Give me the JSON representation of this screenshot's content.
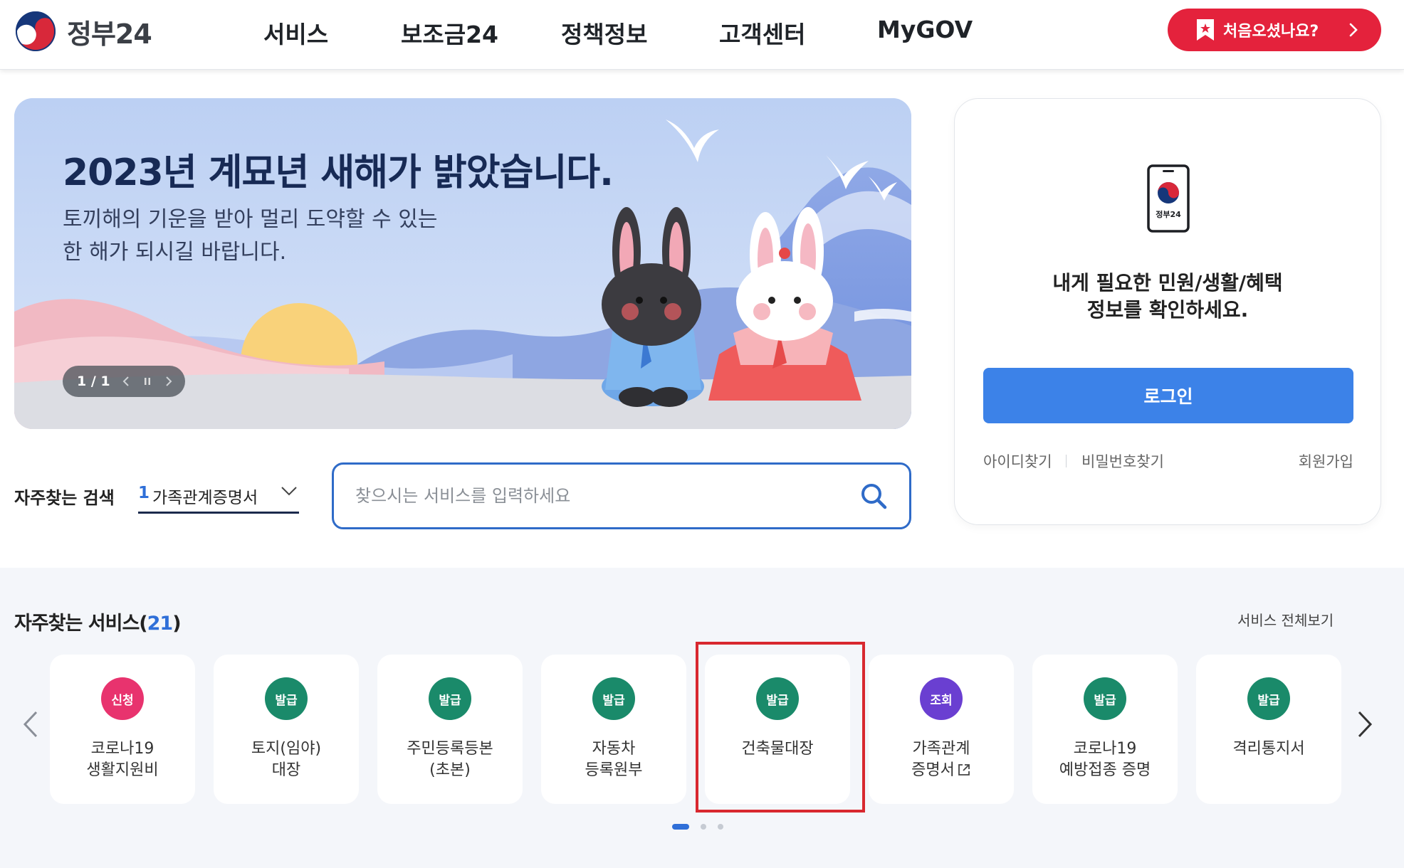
{
  "header": {
    "logo_text": "정부24",
    "nav": [
      "서비스",
      "보조금24",
      "정책정보",
      "고객센터",
      "MyGOV"
    ],
    "first_visit_label": "처음오셨나요?",
    "accent_color": "#e4223c"
  },
  "banner": {
    "title": "2023년 계묘년 새해가 밝았습니다.",
    "subtitle_line1": "토끼해의 기운을 받아 멀리 도약할 수 있는",
    "subtitle_line2": "한 해가 되시길 바랍니다.",
    "pagination": "1 / 1"
  },
  "login": {
    "phone_label": "정부24",
    "message_line1": "내게 필요한 민원/생활/혜택",
    "message_line2": "정보를 확인하세요.",
    "login_button": "로그인",
    "find_id": "아이디찾기",
    "find_pw": "비밀번호찾기",
    "signup": "회원가입",
    "button_color": "#3c82e8"
  },
  "search": {
    "frequent_label": "자주찾는 검색",
    "selected_rank": "1",
    "selected_value": "가족관계증명서",
    "placeholder": "찾으시는 서비스를 입력하세요"
  },
  "services": {
    "title": "자주찾는 서비스",
    "count": "21",
    "view_all": "서비스 전체보기",
    "items": [
      {
        "badge": "신청",
        "badge_color": "#e8336e",
        "name": "코로나19\n생활지원비"
      },
      {
        "badge": "발급",
        "badge_color": "#1a8a6a",
        "name": "토지(임야)\n대장"
      },
      {
        "badge": "발급",
        "badge_color": "#1a8a6a",
        "name": "주민등록등본\n(초본)"
      },
      {
        "badge": "발급",
        "badge_color": "#1a8a6a",
        "name": "자동차\n등록원부"
      },
      {
        "badge": "발급",
        "badge_color": "#1a8a6a",
        "name": "건축물대장"
      },
      {
        "badge": "조회",
        "badge_color": "#6a3fd1",
        "name": "가족관계\n증명서"
      },
      {
        "badge": "발급",
        "badge_color": "#1a8a6a",
        "name": "코로나19\n예방접종 증명"
      },
      {
        "badge": "발급",
        "badge_color": "#1a8a6a",
        "name": "격리통지서"
      }
    ],
    "highlight_color": "#d8282f"
  }
}
